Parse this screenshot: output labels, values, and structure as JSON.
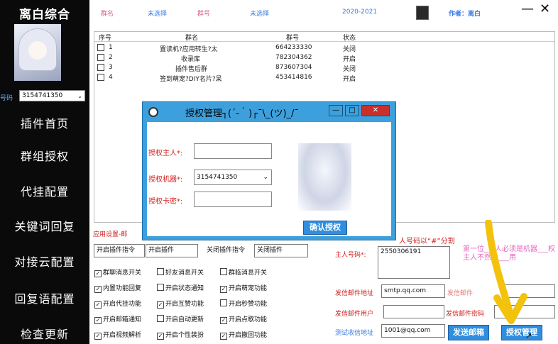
{
  "sidebar": {
    "title": "离白综合",
    "account_label": "号码",
    "account_value": "3154741350",
    "nav": [
      "插件首页",
      "群组授权",
      "代挂配置",
      "关键词回复",
      "对接云配置",
      "回复语配置",
      "检查更新"
    ]
  },
  "topbar": {
    "group_name_label": "群名",
    "group_name_value": "未选择",
    "group_id_label": "群号",
    "group_id_value": "未选择",
    "year": "2020-2021",
    "author": "作者：离白",
    "minimize": "—",
    "close": "✕"
  },
  "table": {
    "headers": [
      "序号",
      "群名",
      "群号",
      "状态"
    ],
    "rows": [
      {
        "index": "1",
        "name": "置读机?应用转生?太",
        "id": "664233330",
        "status": "关闭"
      },
      {
        "index": "2",
        "name": "收录库",
        "id": "782304362",
        "status": "开启"
      },
      {
        "index": "3",
        "name": "插件售后群",
        "id": "873607304",
        "status": "关闭"
      },
      {
        "index": "4",
        "name": "签到萌宠?DIY名片?呆",
        "id": "453414816",
        "status": "开启"
      }
    ]
  },
  "settings": {
    "section_label": "应用设置-邮",
    "open_cmd_label": "开启插件指令",
    "open_cmd_value": "开启插件",
    "close_cmd_label": "关闭插件指令",
    "close_cmd_value": "关闭插件",
    "checkboxes": [
      {
        "label": "群聊消息开关",
        "checked": "✓"
      },
      {
        "label": "好友消息开关",
        "checked": ""
      },
      {
        "label": "群临消息开关",
        "checked": ""
      },
      {
        "label": "内置功能回复",
        "checked": "✓"
      },
      {
        "label": "开启状态通知",
        "checked": ""
      },
      {
        "label": "开启萌宠功能",
        "checked": "✓"
      },
      {
        "label": "开启代挂功能",
        "checked": "✓"
      },
      {
        "label": "开启互赞功能",
        "checked": "✓"
      },
      {
        "label": "开启秒赞功能",
        "checked": ""
      },
      {
        "label": "开启邮箱通知",
        "checked": "✓"
      },
      {
        "label": "开启自动更新",
        "checked": ""
      },
      {
        "label": "开启点歌功能",
        "checked": "✓"
      },
      {
        "label": "开启视频解析",
        "checked": "✓"
      },
      {
        "label": "开启个性装扮",
        "checked": "✓"
      },
      {
        "label": "开启撤回功能",
        "checked": "✓"
      }
    ]
  },
  "mail": {
    "owner_hint": "人号码以“#”分割",
    "owner_label": "主人号码*:",
    "owner_value": "2550306191",
    "smtp_label": "发信邮件地址",
    "smtp_value": "smtp.qq.com",
    "sender_label": "发信邮件",
    "user_label": "发信邮件用户",
    "password_label": "发信邮件密码",
    "test_label": "测试收信地址",
    "test_value": "1001@qq.com",
    "send_button": "发送邮箱",
    "auth_button": "授权管理",
    "note": "第一位___人必须是机器___权主人不然会___用"
  },
  "dialog": {
    "title": "授权管理┐(´-｀)┌¯\\_(ツ)_/¯",
    "owner_label": "授权主人*:",
    "owner_value": "",
    "robot_label": "授权机器*:",
    "robot_value": "3154741350",
    "card_label": "授权卡密*:",
    "card_value": "",
    "confirm_button": "确认授权",
    "minimize": "—",
    "maximize": "□",
    "close": "✕"
  },
  "colors": {
    "accent": "#3da0dd",
    "sidebar": "#0a0a0a",
    "label_red": "#d02020",
    "pink": "#e06080",
    "arrow": "#f2c20c"
  }
}
